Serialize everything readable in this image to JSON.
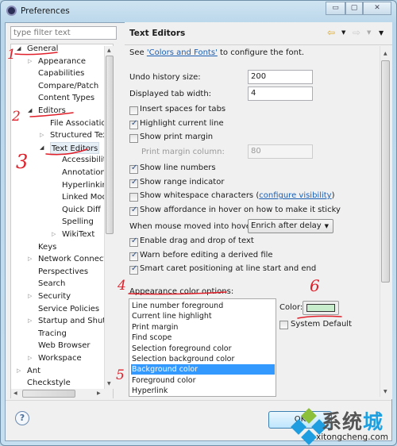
{
  "window": {
    "title": "Preferences",
    "minimize": "▭",
    "maximize": "▢",
    "close": "✕"
  },
  "sidebar": {
    "filter_placeholder": "type filter text",
    "items": [
      {
        "label": "General",
        "level": 0,
        "exp": "open"
      },
      {
        "label": "Appearance",
        "level": 1,
        "exp": "closed"
      },
      {
        "label": "Capabilities",
        "level": 1
      },
      {
        "label": "Compare/Patch",
        "level": 1
      },
      {
        "label": "Content Types",
        "level": 1
      },
      {
        "label": "Editors",
        "level": 1,
        "exp": "open"
      },
      {
        "label": "File Associations",
        "level": 2
      },
      {
        "label": "Structured Text",
        "level": 2,
        "exp": "closed"
      },
      {
        "label": "Text Editors",
        "level": 2,
        "exp": "open",
        "selected": true
      },
      {
        "label": "Accessibility",
        "level": 3
      },
      {
        "label": "Annotations",
        "level": 3
      },
      {
        "label": "Hyperlinking",
        "level": 3
      },
      {
        "label": "Linked Mode",
        "level": 3
      },
      {
        "label": "Quick Diff",
        "level": 3
      },
      {
        "label": "Spelling",
        "level": 3
      },
      {
        "label": "WikiText",
        "level": 3,
        "exp": "closed"
      },
      {
        "label": "Keys",
        "level": 1
      },
      {
        "label": "Network Connections",
        "level": 1,
        "exp": "closed"
      },
      {
        "label": "Perspectives",
        "level": 1
      },
      {
        "label": "Search",
        "level": 1
      },
      {
        "label": "Security",
        "level": 1,
        "exp": "closed"
      },
      {
        "label": "Service Policies",
        "level": 1
      },
      {
        "label": "Startup and Shutdown",
        "level": 1,
        "exp": "closed"
      },
      {
        "label": "Tracing",
        "level": 1
      },
      {
        "label": "Web Browser",
        "level": 1
      },
      {
        "label": "Workspace",
        "level": 1,
        "exp": "closed"
      },
      {
        "label": "Ant",
        "level": 0,
        "exp": "closed"
      },
      {
        "label": "Checkstyle",
        "level": 0
      }
    ]
  },
  "page": {
    "title": "Text Editors",
    "nav": {
      "back": "⇦",
      "forward": "⇨",
      "menu": "▼"
    },
    "intro_prefix": "See ",
    "intro_link": "'Colors and Fonts'",
    "intro_suffix": " to configure the font.",
    "undo_label": "Undo history size:",
    "undo_value": "200",
    "tab_label": "Displayed tab width:",
    "tab_value": "4",
    "checks1": [
      {
        "label": "Insert spaces for tabs",
        "checked": false
      },
      {
        "label": "Highlight current line",
        "checked": true
      },
      {
        "label": "Show print margin",
        "checked": false
      }
    ],
    "margin_label": "Print margin column:",
    "margin_value": "80",
    "checks2": [
      {
        "label": "Show line numbers",
        "checked": true
      },
      {
        "label": "Show range indicator",
        "checked": true
      },
      {
        "label": "Show whitespace characters (",
        "checked": false,
        "link": "configure visibility",
        "after": ")"
      },
      {
        "label": "Show affordance in hover on how to make it sticky",
        "checked": true
      }
    ],
    "hover_label": "When mouse moved into hover:",
    "hover_value": "Enrich after delay",
    "checks3": [
      {
        "label": "Enable drag and drop of text",
        "checked": true
      },
      {
        "label": "Warn before editing a derived file",
        "checked": true
      },
      {
        "label": "Smart caret positioning at line start and end",
        "checked": true
      }
    ],
    "color_options_label": "Appearance color options:",
    "color_options": [
      "Line number foreground",
      "Current line highlight",
      "Print margin",
      "Find scope",
      "Selection foreground color",
      "Selection background color",
      "Background color",
      "Foreground color",
      "Hyperlink"
    ],
    "selected_option": "Background color",
    "color_label": "Color:",
    "color_value": "#c7edcc",
    "system_default": "System Default",
    "system_default_checked": false
  },
  "footer": {
    "help": "?",
    "ok": "OK"
  },
  "annotations": [
    "1",
    "2",
    "3",
    "4",
    "5",
    "6"
  ],
  "watermark": {
    "text_a": "系统",
    "text_b": "城",
    "url": "xitongcheng.com"
  }
}
